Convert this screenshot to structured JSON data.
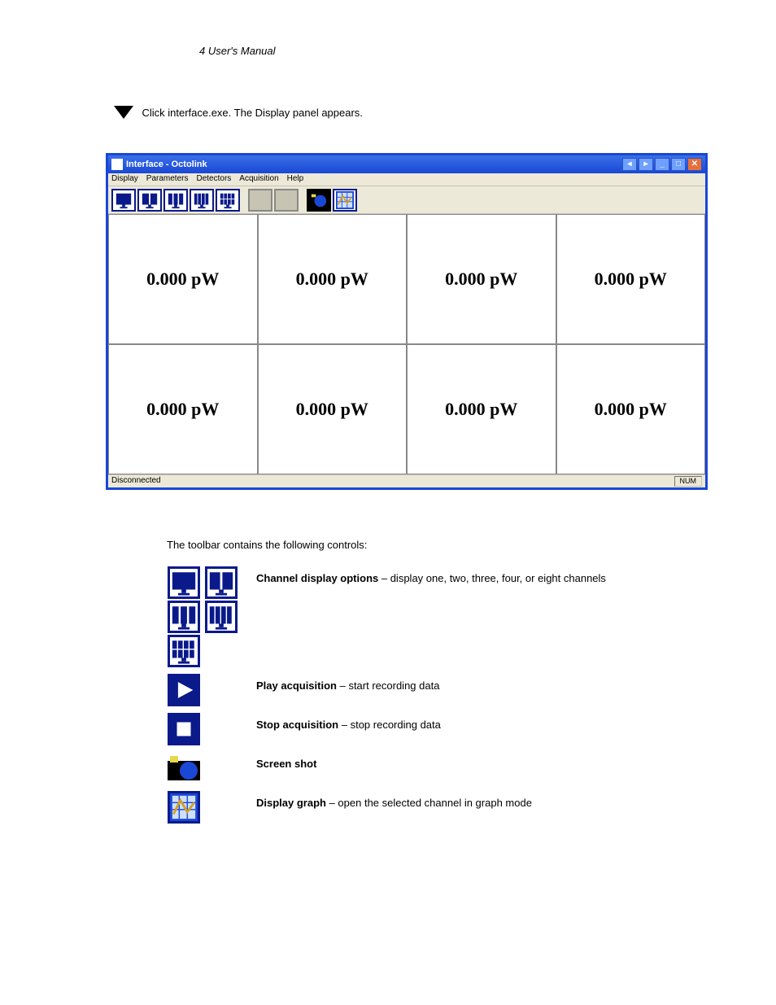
{
  "header": "4 User's Manual",
  "instruction_line": "Click interface.exe.  The Display panel appears.",
  "window": {
    "title": "Interface - Octolink",
    "menus": [
      "Display",
      "Parameters",
      "Detectors",
      "Acquisition",
      "Help"
    ],
    "toolbar_icons": [
      "layout-1",
      "layout-2",
      "layout-3",
      "layout-4",
      "layout-8",
      "play-disabled",
      "stop-disabled",
      "snapshot",
      "graph"
    ],
    "channels": [
      "0.000 pW",
      "0.000 pW",
      "0.000 pW",
      "0.000 pW",
      "0.000 pW",
      "0.000 pW",
      "0.000 pW",
      "0.000 pW"
    ],
    "status_left": "Disconnected",
    "status_right": "NUM"
  },
  "legend": {
    "intro": "The toolbar contains the following controls:",
    "rows": [
      {
        "label": "Channel display options",
        "text": " – display one, two, three, four, or eight channels"
      },
      {
        "label": "Play acquisition",
        "text": " – start recording data"
      },
      {
        "label": "Stop acquisition",
        "text": " – stop recording data"
      },
      {
        "label": "Screen shot",
        "text": ""
      },
      {
        "label": "Display graph",
        "text": " – open the selected channel in graph mode"
      }
    ]
  }
}
